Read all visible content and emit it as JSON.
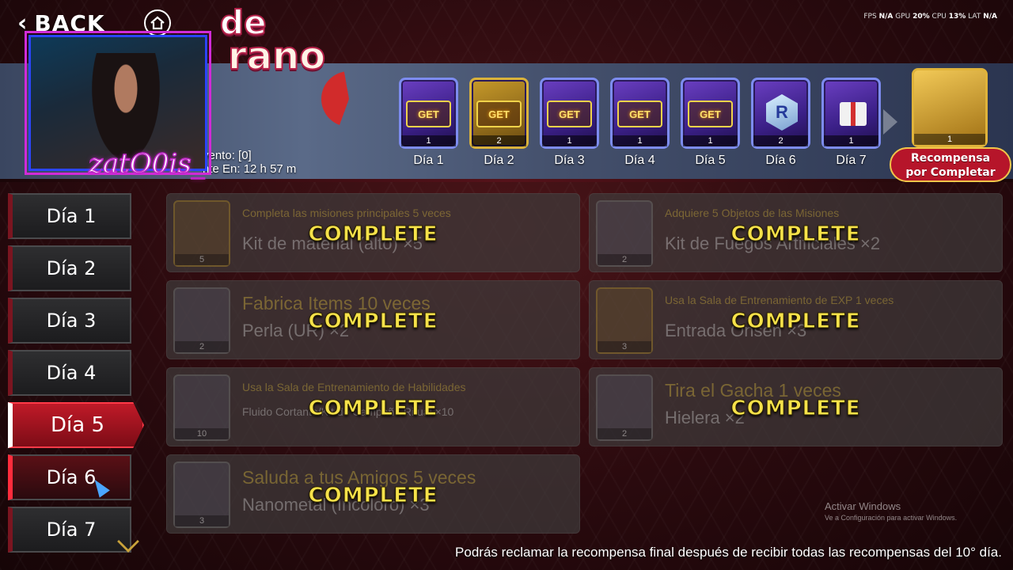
{
  "top_bar": {
    "back_label": "BACK",
    "perf": {
      "fps_label": "FPS",
      "fps_value": "N/A",
      "gpu_label": "GPU",
      "gpu_value": "20%",
      "cpu_label": "CPU",
      "cpu_value": "13%",
      "lat_label": "LAT",
      "lat_value": "N/A"
    }
  },
  "banner": {
    "title_line1": "de",
    "title_line2": "rano",
    "event_line1": "vento: [0]",
    "event_line2": "nte En: 12 h 57 m"
  },
  "rewards": [
    {
      "label": "Día 1",
      "qty": "1",
      "badge": "GET",
      "style": "purple"
    },
    {
      "label": "Día 2",
      "qty": "2",
      "badge": "GET",
      "style": "gold"
    },
    {
      "label": "Día 3",
      "qty": "1",
      "badge": "GET",
      "style": "purple"
    },
    {
      "label": "Día 4",
      "qty": "1",
      "badge": "GET",
      "style": "purple"
    },
    {
      "label": "Día 5",
      "qty": "1",
      "badge": "GET",
      "style": "purple"
    },
    {
      "label": "Día 6",
      "qty": "2",
      "badge": "R",
      "style": "purple"
    },
    {
      "label": "Día 7",
      "qty": "1",
      "badge": "",
      "style": "purple"
    }
  ],
  "final_reward": {
    "qty": "1",
    "label_line1": "Recompensa",
    "label_line2": "por Completar"
  },
  "streamer_name": "zatO0is_",
  "day_tabs": [
    {
      "label": "Día 1",
      "state": "normal"
    },
    {
      "label": "Día 2",
      "state": "normal"
    },
    {
      "label": "Día 3",
      "state": "normal"
    },
    {
      "label": "Día 4",
      "state": "normal"
    },
    {
      "label": "Día 5",
      "state": "active"
    },
    {
      "label": "Día 6",
      "state": "hover"
    },
    {
      "label": "Día 7",
      "state": "normal"
    }
  ],
  "missions": [
    {
      "task": "Completa las misiones principales 5 veces",
      "reward": "Kit de material (alto) ×5",
      "qty": "5",
      "status": "COMPLETE",
      "big": false
    },
    {
      "task": "Adquiere 5 Objetos de las Misiones",
      "reward": "Kit de Fuegos Artificiales ×2",
      "qty": "2",
      "status": "COMPLETE",
      "big": false
    },
    {
      "task": "Fabrica Items 10 veces",
      "reward": "Perla (UR) ×2",
      "qty": "2",
      "status": "COMPLETE",
      "big": true
    },
    {
      "task": "Usa la Sala de Entrenamiento de EXP 1 veces",
      "reward": "Entrada Onsen ×3",
      "qty": "3",
      "status": "COMPLETE",
      "big": false
    },
    {
      "task": "Usa la Sala de Entrenamiento de Habilidades",
      "reward": "Fluido Cortante/Kit de Campaña Ritual ×10",
      "qty": "10",
      "status": "COMPLETE",
      "big": false
    },
    {
      "task": "Tira el Gacha 1 veces",
      "reward": "Hielera ×2",
      "qty": "2",
      "status": "COMPLETE",
      "big": true
    },
    {
      "task": "Saluda a tus Amigos 5 veces",
      "reward": "Nanometal (Incoloro) ×3",
      "qty": "3",
      "status": "COMPLETE",
      "big": true
    }
  ],
  "footer_note": "Podrás reclamar la recompensa final después de recibir todas las recompensas del 10° día.",
  "windows_activation": {
    "line1": "Activar Windows",
    "line2": "Ve a Configuración para activar Windows."
  }
}
